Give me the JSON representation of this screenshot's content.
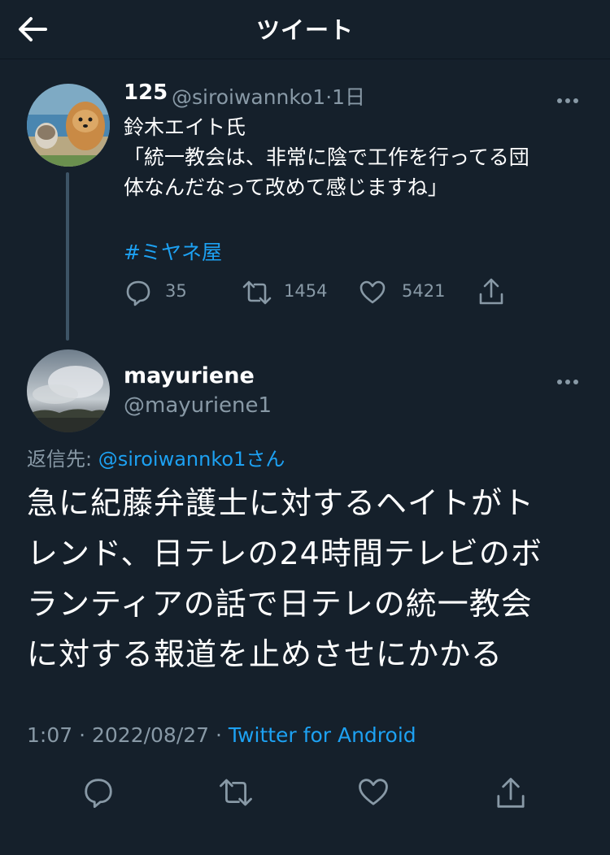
{
  "header": {
    "title": "ツイート",
    "back_icon": "arrow-left-icon"
  },
  "parent_tweet": {
    "display_name": "125",
    "handle": "@siroiwannko1",
    "separator": "·",
    "time": "1日",
    "text_lines": [
      "鈴木エイト氏",
      "「統一教会は、非常に陰で工作を行ってる団",
      "体なんだなって改めて感じますね」"
    ],
    "hashtag": "#ミヤネ屋",
    "reply_count": "35",
    "retweet_count": "1454",
    "like_count": "5421"
  },
  "main_tweet": {
    "display_name": "mayuriene",
    "handle": "@mayuriene1",
    "reply_label": "返信先: ",
    "reply_handle": "@siroiwannko1さん",
    "text_lines": [
      "急に紀藤弁護士に対するヘイトがト",
      "レンド、日テレの24時間テレビのボ",
      "ランティアの話で日テレの統一教会",
      "に対する報道を止めさせにかかる"
    ],
    "time": "1:07",
    "date": "2022/08/27",
    "separator": " · ",
    "client": "Twitter for Android"
  },
  "colors": {
    "background": "#15202b",
    "text_secondary": "#8899a6",
    "link": "#1da1f2",
    "thread_line": "#3d5466"
  }
}
